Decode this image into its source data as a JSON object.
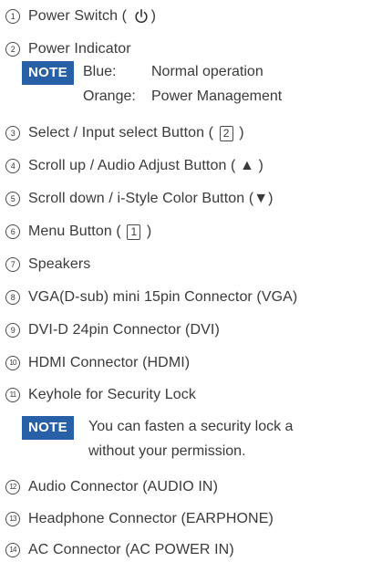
{
  "items": [
    {
      "num": "1",
      "before": "Power Switch ( ",
      "icon": "power-icon",
      "after": ")"
    },
    {
      "num": "2",
      "text": "Power Indicator"
    },
    {
      "num": "3",
      "before": "Select / Input select Button ( ",
      "box": "2",
      "after": " )"
    },
    {
      "num": "4",
      "text": "Scroll up / Audio Adjust Button ( ▲ )"
    },
    {
      "num": "5",
      "text": "Scroll down / i-Style Color Button (▼)"
    },
    {
      "num": "6",
      "before": "Menu Button ( ",
      "box": "1",
      "after": " )"
    },
    {
      "num": "7",
      "text": "Speakers"
    },
    {
      "num": "8",
      "text": "VGA(D-sub) mini 15pin Connector (VGA)"
    },
    {
      "num": "9",
      "text": "DVI-D 24pin Connector (DVI)"
    },
    {
      "num": "10",
      "text": "HDMI Connector (HDMI)"
    },
    {
      "num": "11",
      "text": "Keyhole for Security Lock"
    },
    {
      "num": "12",
      "text": "Audio Connector (AUDIO IN)"
    },
    {
      "num": "13",
      "text": "Headphone Connector (EARPHONE)"
    },
    {
      "num": "14",
      "text": "AC Connector (AC POWER IN)"
    }
  ],
  "note1": {
    "label": "NOTE",
    "rows": [
      {
        "key": "Blue:",
        "value": "Normal operation"
      },
      {
        "key": "Orange:",
        "value": "Power Management"
      }
    ]
  },
  "note2": {
    "label": "NOTE",
    "line1": "You can fasten a security lock a",
    "line2": "without your permission."
  },
  "colors": {
    "note_badge": "#2860a8",
    "text": "#3a3a3a"
  }
}
